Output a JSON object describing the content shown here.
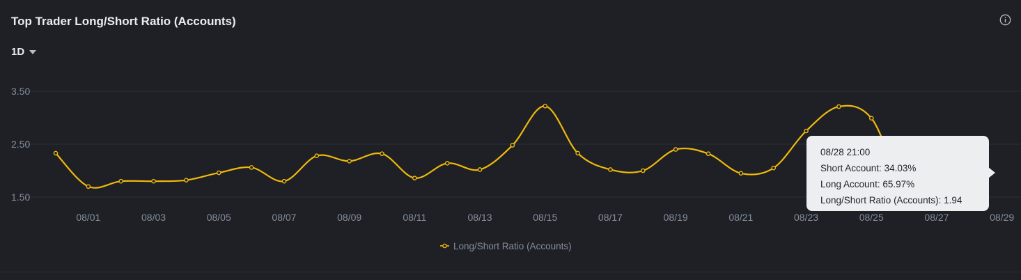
{
  "header": {
    "title": "Top Trader Long/Short Ratio (Accounts)",
    "info_icon": "info-circle-icon"
  },
  "interval": {
    "selected": "1D",
    "icon": "caret-down-icon"
  },
  "tooltip": {
    "time": "08/28 21:00",
    "short_label": "Short Account:",
    "short_value": "34.03%",
    "long_label": "Long Account:",
    "long_value": "65.97%",
    "ratio_label": "Long/Short Ratio (Accounts):",
    "ratio_value": "1.94"
  },
  "colors": {
    "background": "#1e2026",
    "line": "#f0b90b",
    "grid": "#2b2f36",
    "axis_text": "#848e9c",
    "tooltip_bg": "#eceef0"
  },
  "chart_data": {
    "type": "line",
    "ylim": [
      1.5,
      3.5
    ],
    "y_ticks": [
      "3.50",
      "2.50",
      "1.50"
    ],
    "x_ticks": [
      "08/01",
      "08/03",
      "08/05",
      "08/07",
      "08/09",
      "08/11",
      "08/13",
      "08/15",
      "08/17",
      "08/19",
      "08/21",
      "08/23",
      "08/25",
      "08/27",
      "08/29"
    ],
    "x": [
      "07/31",
      "08/01",
      "08/02",
      "08/03",
      "08/04",
      "08/05",
      "08/06",
      "08/07",
      "08/08",
      "08/09",
      "08/10",
      "08/11",
      "08/12",
      "08/13",
      "08/14",
      "08/15",
      "08/16",
      "08/17",
      "08/18",
      "08/19",
      "08/20",
      "08/21",
      "08/22",
      "08/23",
      "08/24",
      "08/25",
      "08/26",
      "08/27",
      "08/28"
    ],
    "series": [
      {
        "name": "Long/Short Ratio (Accounts)",
        "values": [
          2.33,
          1.7,
          1.8,
          1.8,
          1.82,
          1.96,
          2.06,
          1.8,
          2.28,
          2.18,
          2.32,
          1.86,
          2.14,
          2.02,
          2.48,
          3.22,
          2.33,
          2.02,
          2.0,
          2.4,
          2.32,
          1.95,
          2.05,
          2.75,
          3.21,
          2.99,
          1.72,
          1.78,
          1.94
        ]
      }
    ],
    "highlight_index": 28,
    "legend": "bottom-center"
  }
}
